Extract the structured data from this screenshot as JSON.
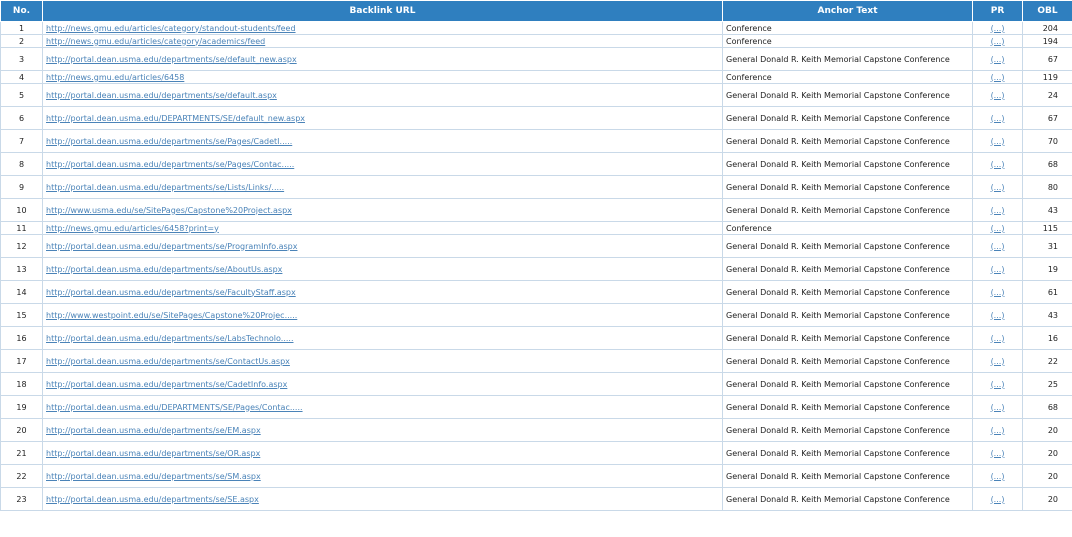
{
  "table": {
    "columns": [
      "No.",
      "Backlink URL",
      "Anchor Text",
      "PR",
      "OBL"
    ],
    "rows": [
      {
        "no": "1",
        "url": "http://news.gmu.edu/articles/category/standout-students/feed",
        "anchor": "Conference",
        "pr": "(...)",
        "obl": "204"
      },
      {
        "no": "2",
        "url": "http://news.gmu.edu/articles/category/academics/feed",
        "anchor": "Conference",
        "pr": "(...)",
        "obl": "194"
      },
      {
        "no": "3",
        "url": "http://portal.dean.usma.edu/departments/se/default_new.aspx",
        "anchor": "General Donald R. Keith Memorial Capstone Conference",
        "pr": "(...)",
        "obl": "67"
      },
      {
        "no": "4",
        "url": "http://news.gmu.edu/articles/6458",
        "anchor": "Conference",
        "pr": "(...)",
        "obl": "119"
      },
      {
        "no": "5",
        "url": "http://portal.dean.usma.edu/departments/se/default.aspx",
        "anchor": "General Donald R. Keith Memorial Capstone Conference",
        "pr": "(...)",
        "obl": "24"
      },
      {
        "no": "6",
        "url": "http://portal.dean.usma.edu/DEPARTMENTS/SE/default_new.aspx",
        "anchor": "General Donald R. Keith Memorial Capstone Conference",
        "pr": "(...)",
        "obl": "67"
      },
      {
        "no": "7",
        "url": "http://portal.dean.usma.edu/departments/se/Pages/CadetI.....",
        "anchor": "General Donald R. Keith Memorial Capstone Conference",
        "pr": "(...)",
        "obl": "70"
      },
      {
        "no": "8",
        "url": "http://portal.dean.usma.edu/departments/se/Pages/Contac.....",
        "anchor": "General Donald R. Keith Memorial Capstone Conference",
        "pr": "(...)",
        "obl": "68"
      },
      {
        "no": "9",
        "url": "http://portal.dean.usma.edu/departments/se/Lists/Links/.....",
        "anchor": "General Donald R. Keith Memorial Capstone Conference",
        "pr": "(...)",
        "obl": "80"
      },
      {
        "no": "10",
        "url": "http://www.usma.edu/se/SitePages/Capstone%20Project.aspx",
        "anchor": "General Donald R. Keith Memorial Capstone Conference",
        "pr": "(...)",
        "obl": "43"
      },
      {
        "no": "11",
        "url": "http://news.gmu.edu/articles/6458?print=y",
        "anchor": "Conference",
        "pr": "(...)",
        "obl": "115"
      },
      {
        "no": "12",
        "url": "http://portal.dean.usma.edu/departments/se/ProgramInfo.aspx",
        "anchor": "General Donald R. Keith Memorial Capstone Conference",
        "pr": "(...)",
        "obl": "31"
      },
      {
        "no": "13",
        "url": "http://portal.dean.usma.edu/departments/se/AboutUs.aspx",
        "anchor": "General Donald R. Keith Memorial Capstone Conference",
        "pr": "(...)",
        "obl": "19"
      },
      {
        "no": "14",
        "url": "http://portal.dean.usma.edu/departments/se/FacultyStaff.aspx",
        "anchor": "General Donald R. Keith Memorial Capstone Conference",
        "pr": "(...)",
        "obl": "61"
      },
      {
        "no": "15",
        "url": "http://www.westpoint.edu/se/SitePages/Capstone%20Projec.....",
        "anchor": "General Donald R. Keith Memorial Capstone Conference",
        "pr": "(...)",
        "obl": "43"
      },
      {
        "no": "16",
        "url": "http://portal.dean.usma.edu/departments/se/LabsTechnolo.....",
        "anchor": "General Donald R. Keith Memorial Capstone Conference",
        "pr": "(...)",
        "obl": "16"
      },
      {
        "no": "17",
        "url": "http://portal.dean.usma.edu/departments/se/ContactUs.aspx",
        "anchor": "General Donald R. Keith Memorial Capstone Conference",
        "pr": "(...)",
        "obl": "22"
      },
      {
        "no": "18",
        "url": "http://portal.dean.usma.edu/departments/se/CadetInfo.aspx",
        "anchor": "General Donald R. Keith Memorial Capstone Conference",
        "pr": "(...)",
        "obl": "25"
      },
      {
        "no": "19",
        "url": "http://portal.dean.usma.edu/DEPARTMENTS/SE/Pages/Contac.....",
        "anchor": "General Donald R. Keith Memorial Capstone Conference",
        "pr": "(...)",
        "obl": "68"
      },
      {
        "no": "20",
        "url": "http://portal.dean.usma.edu/departments/se/EM.aspx",
        "anchor": "General Donald R. Keith Memorial Capstone Conference",
        "pr": "(...)",
        "obl": "20"
      },
      {
        "no": "21",
        "url": "http://portal.dean.usma.edu/departments/se/OR.aspx",
        "anchor": "General Donald R. Keith Memorial Capstone Conference",
        "pr": "(...)",
        "obl": "20"
      },
      {
        "no": "22",
        "url": "http://portal.dean.usma.edu/departments/se/SM.aspx",
        "anchor": "General Donald R. Keith Memorial Capstone Conference",
        "pr": "(...)",
        "obl": "20"
      },
      {
        "no": "23",
        "url": "http://portal.dean.usma.edu/departments/se/SE.aspx",
        "anchor": "General Donald R. Keith Memorial Capstone Conference",
        "pr": "(...)",
        "obl": "20"
      }
    ]
  },
  "colors": {
    "header_bg": "#2f7fbf",
    "link": "#4a83b8",
    "grid": "#c9d9e8"
  }
}
